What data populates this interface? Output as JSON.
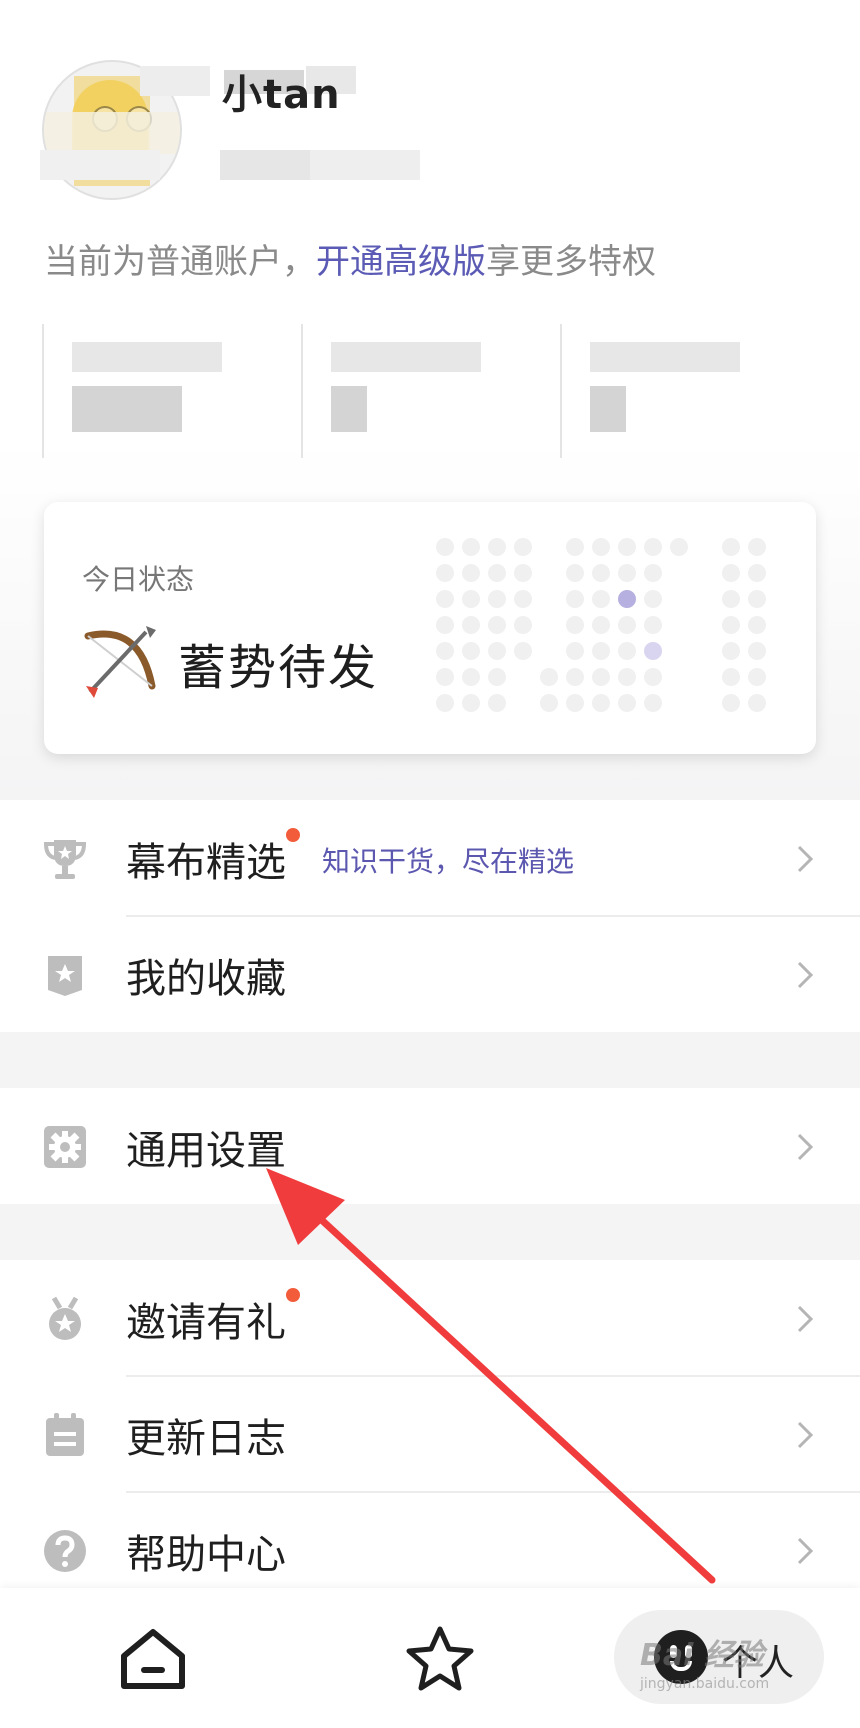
{
  "profile": {
    "username": "小tan",
    "account_prefix": "当前为普通账户，",
    "account_link": "开通高级版",
    "account_suffix": "享更多特权"
  },
  "stats": [
    {
      "label": "",
      "value": ""
    },
    {
      "label": "",
      "value": ""
    },
    {
      "label": "",
      "value": ""
    }
  ],
  "today": {
    "title": "今日状态",
    "status": "蓄势待发"
  },
  "menu": {
    "featured": {
      "label": "幕布精选",
      "tag": "知识干货，尽在精选"
    },
    "favorites": {
      "label": "我的收藏"
    },
    "settings": {
      "label": "通用设置"
    },
    "invite": {
      "label": "邀请有礼"
    },
    "changelog": {
      "label": "更新日志"
    },
    "help": {
      "label": "帮助中心"
    }
  },
  "nav": {
    "home_icon": "home-icon",
    "star_icon": "star-icon",
    "me_label": "个人"
  },
  "watermark": {
    "text": "Bai 经验",
    "sub": "jingyan.baidu.com"
  },
  "colors": {
    "accent": "#5b5bb5",
    "badge_red": "#f25c3b",
    "arrow": "#f03c3c"
  }
}
